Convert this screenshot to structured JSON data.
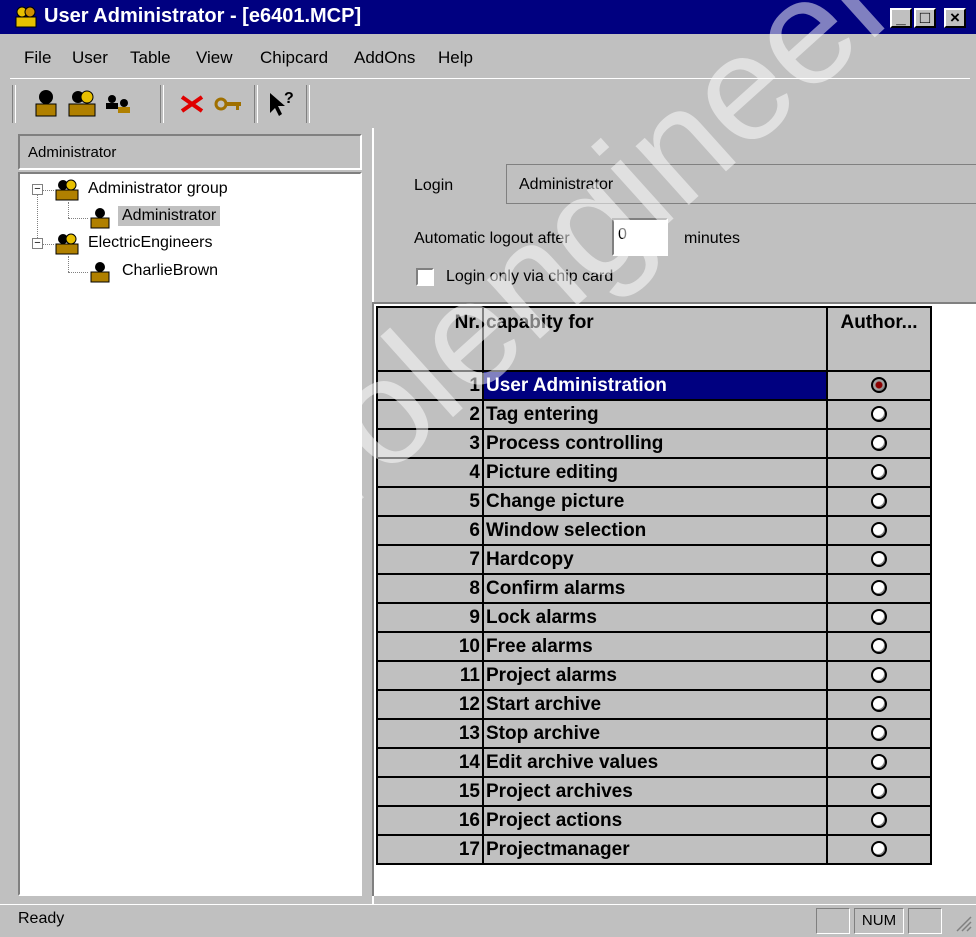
{
  "window": {
    "title": "User Administrator - [e6401.MCP]"
  },
  "menu": [
    {
      "label": "File"
    },
    {
      "label": "User"
    },
    {
      "label": "Table"
    },
    {
      "label": "View"
    },
    {
      "label": "Chipcard"
    },
    {
      "label": "AddOns"
    },
    {
      "label": "Help"
    }
  ],
  "toolbar": {
    "icons": [
      "user-icon",
      "group-icon",
      "user-properties-icon",
      "delete-icon",
      "key-icon",
      "help-pointer-icon"
    ]
  },
  "left": {
    "header": "Administrator",
    "tree": [
      {
        "label": "Administrator group",
        "type": "group"
      },
      {
        "label": "Administrator",
        "type": "user",
        "selected": true
      },
      {
        "label": "ElectricEngineers",
        "type": "group"
      },
      {
        "label": "CharlieBrown",
        "type": "user"
      }
    ]
  },
  "form": {
    "login_label": "Login",
    "login_value": "Administrator",
    "logout_label": "Automatic logout after",
    "logout_value": "0",
    "minutes_label": "minutes",
    "chipcard_label": "Login only via chip card",
    "chipcard_checked": false
  },
  "grid": {
    "headers": {
      "nr": "Nr.",
      "capability": "capabity for",
      "auth": "Author..."
    },
    "rows": [
      {
        "nr": "1",
        "capability": "User Administration",
        "authorized": true,
        "selected": true
      },
      {
        "nr": "2",
        "capability": "Tag entering",
        "authorized": false
      },
      {
        "nr": "3",
        "capability": "Process controlling",
        "authorized": false
      },
      {
        "nr": "4",
        "capability": "Picture editing",
        "authorized": false
      },
      {
        "nr": "5",
        "capability": "Change picture",
        "authorized": false
      },
      {
        "nr": "6",
        "capability": "Window selection",
        "authorized": false
      },
      {
        "nr": "7",
        "capability": "Hardcopy",
        "authorized": false
      },
      {
        "nr": "8",
        "capability": "Confirm alarms",
        "authorized": false
      },
      {
        "nr": "9",
        "capability": "Lock alarms",
        "authorized": false
      },
      {
        "nr": "10",
        "capability": "Free alarms",
        "authorized": false
      },
      {
        "nr": "11",
        "capability": "Project alarms",
        "authorized": false
      },
      {
        "nr": "12",
        "capability": "Start archive",
        "authorized": false
      },
      {
        "nr": "13",
        "capability": "Stop archive",
        "authorized": false
      },
      {
        "nr": "14",
        "capability": "Edit archive values",
        "authorized": false
      },
      {
        "nr": "15",
        "capability": "Project archives",
        "authorized": false
      },
      {
        "nr": "16",
        "capability": "Project actions",
        "authorized": false
      },
      {
        "nr": "17",
        "capability": "Projectmanager",
        "authorized": false
      }
    ]
  },
  "status": {
    "text": "Ready",
    "num": "NUM"
  },
  "watermark": "controlengineers"
}
